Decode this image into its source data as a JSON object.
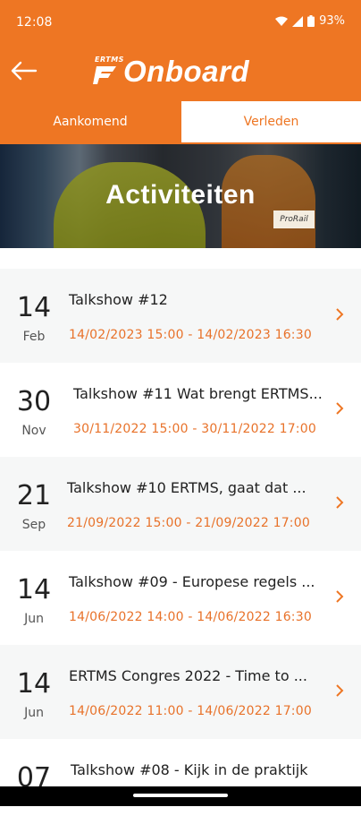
{
  "status": {
    "time": "12:08",
    "battery": "93%"
  },
  "header": {
    "logo_small": "ERTMS",
    "logo_word": "Onboard",
    "brand_color": "#ee7623"
  },
  "tabs": [
    {
      "label": "Aankomend",
      "selected": false
    },
    {
      "label": "Verleden",
      "selected": true
    }
  ],
  "banner": {
    "title": "Activiteiten",
    "sign_text": "ProRail"
  },
  "items": [
    {
      "day": "14",
      "month": "Feb",
      "title": "Talkshow #12",
      "dates": "14/02/2023 15:00 - 14/02/2023 16:30"
    },
    {
      "day": "30",
      "month": "Nov",
      "title": "Talkshow #11 Wat brengt ERTMS...",
      "dates": "30/11/2022 15:00 - 30/11/2022 17:00"
    },
    {
      "day": "21",
      "month": "Sep",
      "title": "Talkshow #10 ERTMS, gaat dat ...",
      "dates": "21/09/2022 15:00 - 21/09/2022 17:00"
    },
    {
      "day": "14",
      "month": "Jun",
      "title": "Talkshow #09 - Europese regels ...",
      "dates": "14/06/2022 14:00 - 14/06/2022 16:30"
    },
    {
      "day": "14",
      "month": "Jun",
      "title": "ERTMS Congres 2022 - Time to ...",
      "dates": "14/06/2022 11:00 - 14/06/2022 17:00"
    },
    {
      "day": "07",
      "month": "",
      "title": "Talkshow #08 - Kijk in de praktijk",
      "dates": ""
    }
  ]
}
